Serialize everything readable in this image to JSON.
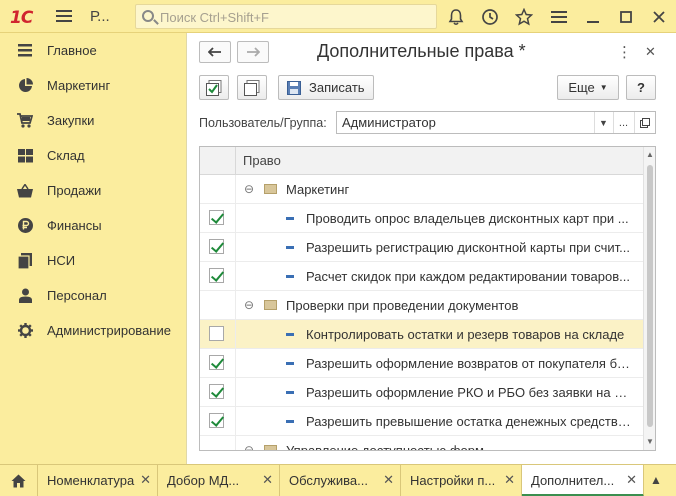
{
  "topbar": {
    "logo": "1С",
    "app_title": "Р...",
    "search_placeholder": "Поиск Ctrl+Shift+F",
    "icons": [
      "bell-icon",
      "history-icon",
      "star-icon",
      "more-menu-icon",
      "minimize-icon",
      "maximize-icon",
      "close-icon"
    ]
  },
  "sidebar": {
    "items": [
      {
        "label": "Главное",
        "icon": "list-icon"
      },
      {
        "label": "Маркетинг",
        "icon": "pie-chart-icon"
      },
      {
        "label": "Закупки",
        "icon": "cart-icon"
      },
      {
        "label": "Склад",
        "icon": "warehouse-icon"
      },
      {
        "label": "Продажи",
        "icon": "basket-icon"
      },
      {
        "label": "Финансы",
        "icon": "ruble-icon"
      },
      {
        "label": "НСИ",
        "icon": "documents-icon"
      },
      {
        "label": "Персонал",
        "icon": "person-icon"
      },
      {
        "label": "Администрирование",
        "icon": "gear-icon"
      }
    ]
  },
  "form": {
    "title": "Дополнительные права *",
    "save_label": "Записать",
    "more_label": "Еще",
    "help_label": "?",
    "user_group_label": "Пользователь/Группа:",
    "user_group_value": "Администратор",
    "more_field_label": "..."
  },
  "table": {
    "column_header": "Право",
    "rows": [
      {
        "type": "group",
        "text": "Маркетинг"
      },
      {
        "type": "item",
        "checked": true,
        "text": "Проводить опрос владельцев дисконтных карт при ..."
      },
      {
        "type": "item",
        "checked": true,
        "text": "Разрешить регистрацию дисконтной карты при счит..."
      },
      {
        "type": "item",
        "checked": true,
        "text": "Расчет скидок при каждом редактировании товаров..."
      },
      {
        "type": "group",
        "text": "Проверки при проведении документов"
      },
      {
        "type": "item",
        "checked": false,
        "selected": true,
        "text": "Контролировать остатки и резерв товаров на складе"
      },
      {
        "type": "item",
        "checked": true,
        "text": "Разрешить оформление возвратов от покупателя бе..."
      },
      {
        "type": "item",
        "checked": true,
        "text": "Разрешить оформление РКО и РБО без заявки на р..."
      },
      {
        "type": "item",
        "checked": true,
        "text": "Разрешить превышение остатка денежных средств ..."
      },
      {
        "type": "group",
        "text": "Управление доступностью форм"
      }
    ]
  },
  "bottom_tabs": [
    {
      "label": "Номенклатура",
      "active": false
    },
    {
      "label": "Добор  МД...",
      "active": false
    },
    {
      "label": "Обслужива...",
      "active": false
    },
    {
      "label": "Настройки п...",
      "active": false
    },
    {
      "label": "Дополнител...",
      "active": true
    }
  ],
  "colors": {
    "background": "#fbed9e",
    "accent_green": "#3b8f4f",
    "logo_red": "#d0252f"
  }
}
